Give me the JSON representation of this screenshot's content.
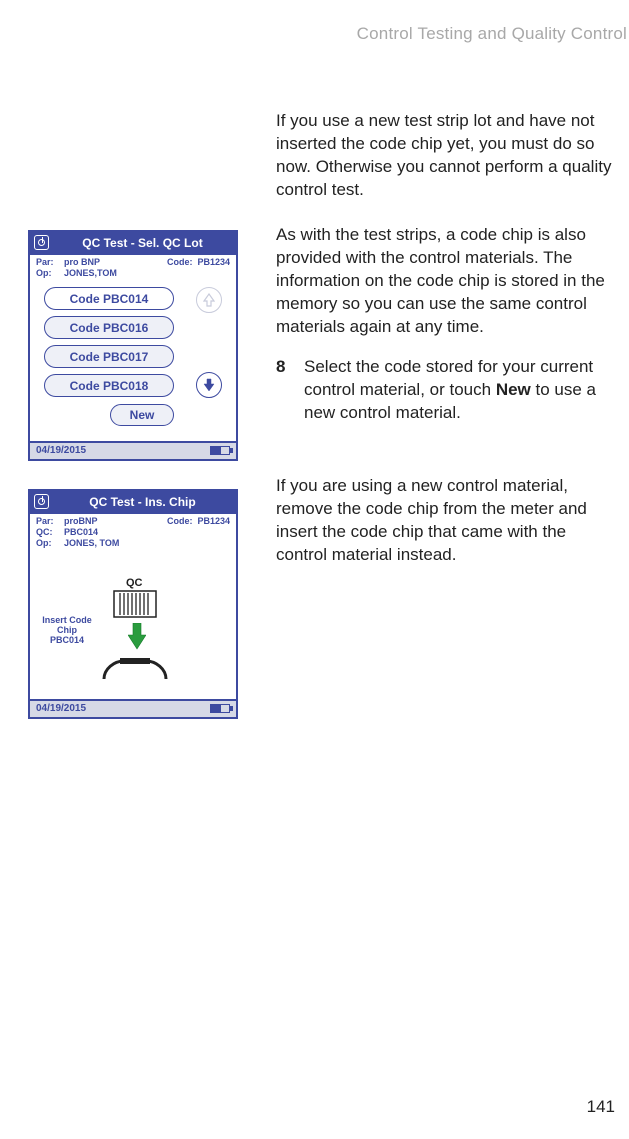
{
  "running_head": "Control Testing and Quality Control",
  "page_number": "141",
  "para1": "If you use a new test strip lot and have not inserted the code chip yet, you must do so now. Otherwise you cannot perform a quality control test.",
  "para2": "As with the test strips, a code chip is also pro­vided with the control materials. The informa­tion on the code chip is stored in the memory so you can use the same control materials again at any time.",
  "step": {
    "num": "8",
    "text_before": "Select the code stored for your current control material, or touch ",
    "bold": "New",
    "text_after": " to use a new control material."
  },
  "para3": "If you are using a new control material, remove the code chip from the meter and insert the code chip that came with the control material instead.",
  "screen1": {
    "title": "QC Test - Sel. QC Lot",
    "par_label": "Par:",
    "par_value": "pro BNP",
    "code_label": "Code:",
    "code_value": "PB1234",
    "op_label": "Op:",
    "op_value": "JONES,TOM",
    "codes": [
      "Code PBC014",
      "Code PBC016",
      "Code PBC017",
      "Code PBC018"
    ],
    "new_label": "New",
    "date": "04/19/2015"
  },
  "screen2": {
    "title": "QC Test - Ins. Chip",
    "par_label": "Par:",
    "par_value": "proBNP",
    "qc_label": "QC:",
    "qc_value": "PBC014",
    "op_label": "Op:",
    "op_value": "JONES, TOM",
    "code_label": "Code:",
    "code_value": "PB1234",
    "insert_line1": "Insert Code",
    "insert_line2": "Chip",
    "insert_line3": "PBC014",
    "qc_chip_label": "QC",
    "date": "04/19/2015"
  }
}
